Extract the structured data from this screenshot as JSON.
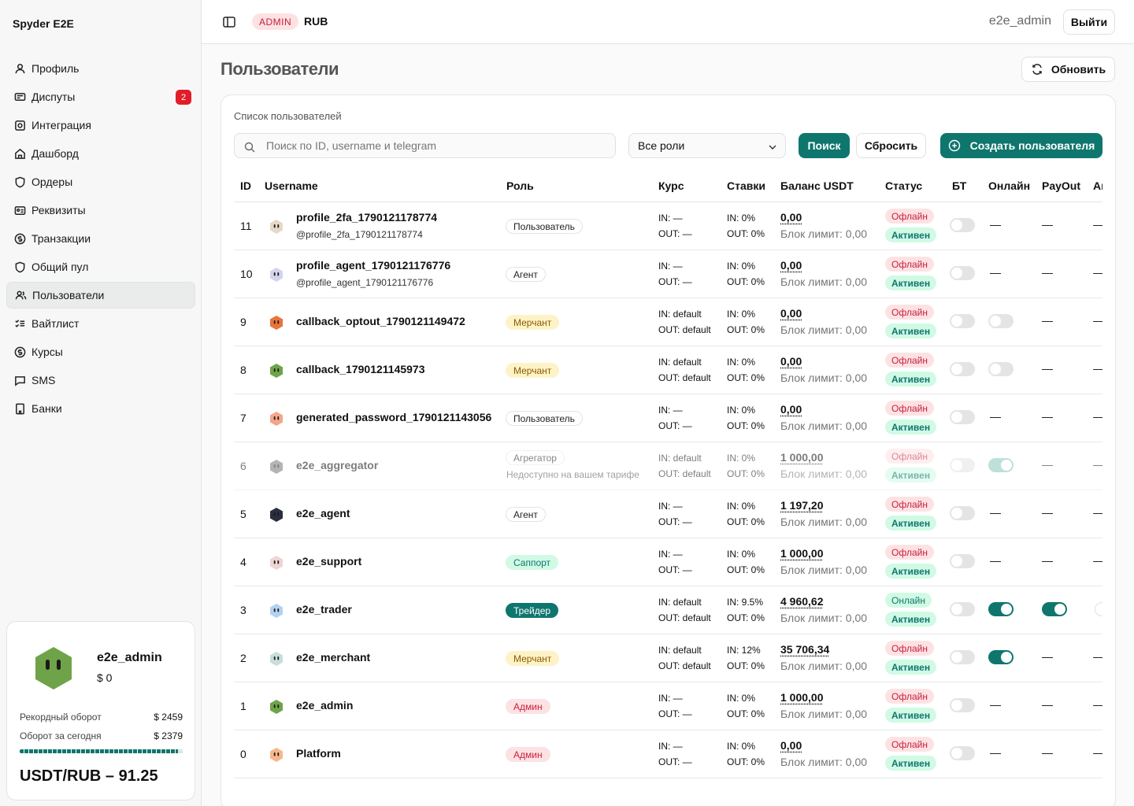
{
  "brand": "Spyder E2E",
  "nav": [
    {
      "label": "Профиль",
      "icon": "user-icon"
    },
    {
      "label": "Диспуты",
      "icon": "dispute-icon",
      "badge": "2"
    },
    {
      "label": "Интеграция",
      "icon": "integration-icon"
    },
    {
      "label": "Дашборд",
      "icon": "home-icon"
    },
    {
      "label": "Ордеры",
      "icon": "shield-icon"
    },
    {
      "label": "Реквизиты",
      "icon": "card-icon"
    },
    {
      "label": "Транзакции",
      "icon": "dollar-icon"
    },
    {
      "label": "Общий пул",
      "icon": "shield-icon"
    },
    {
      "label": "Пользователи",
      "icon": "users-icon",
      "active": true
    },
    {
      "label": "Вайтлист",
      "icon": "checklist-icon"
    },
    {
      "label": "Курсы",
      "icon": "dollar-icon"
    },
    {
      "label": "SMS",
      "icon": "message-icon"
    },
    {
      "label": "Банки",
      "icon": "bank-icon"
    }
  ],
  "profile_card": {
    "name": "e2e_admin",
    "balance": "$ 0",
    "record_label": "Рекордный оборот",
    "record_value": "$ 2459",
    "today_label": "Оборот за сегодня",
    "today_value": "$ 2379",
    "progress": 0.97,
    "rate": "USDT/RUB – 91.25"
  },
  "header": {
    "badge": "ADMIN",
    "currency": "RUB",
    "user": "e2e_admin",
    "logout": "Выйти"
  },
  "page": {
    "title": "Пользователи",
    "refresh": "Обновить"
  },
  "panel": {
    "title": "Список пользователей",
    "search_placeholder": "Поиск по ID, username и telegram",
    "roles": "Все роли",
    "search_btn": "Поиск",
    "reset_btn": "Сбросить",
    "create_btn": "Создать пользователя"
  },
  "columns": [
    "ID",
    "Username",
    "Роль",
    "Курс",
    "Ставки",
    "Баланс USDT",
    "Статус",
    "БТ",
    "Онлайн",
    "PayOut",
    "Аг"
  ],
  "colors": {
    "accent": "#0f766e",
    "danger": "#c81e3a"
  },
  "rows": [
    {
      "id": "11",
      "username": "profile_2fa_1790121178774",
      "handle": "@profile_2fa_1790121178774",
      "role": "Пользователь",
      "role_class": "r-user",
      "kurs_in": "IN: —",
      "kurs_out": "OUT: —",
      "st_in": "IN: 0%",
      "st_out": "OUT: 0%",
      "balance": "0,00",
      "limit": "Блок лимит: 0,00",
      "status": "Офлайн",
      "active": "Активен",
      "avatar": "#e6d8c8",
      "online": "—",
      "payout": "—",
      "agg": "—"
    },
    {
      "id": "10",
      "username": "profile_agent_1790121176776",
      "handle": "@profile_agent_1790121176776",
      "role": "Агент",
      "role_class": "r-agent",
      "kurs_in": "IN: —",
      "kurs_out": "OUT: —",
      "st_in": "IN: 0%",
      "st_out": "OUT: 0%",
      "balance": "0,00",
      "limit": "Блок лимит: 0,00",
      "status": "Офлайн",
      "active": "Активен",
      "avatar": "#d4d4ee",
      "online": "—",
      "payout": "—",
      "agg": "—"
    },
    {
      "id": "9",
      "username": "callback_optout_1790121149472",
      "role": "Мерчант",
      "role_class": "r-merch",
      "kurs_in": "IN: default",
      "kurs_out": "OUT: default",
      "st_in": "IN: 0%",
      "st_out": "OUT: 0%",
      "balance": "0,00",
      "limit": "Блок лимит: 0,00",
      "status": "Офлайн",
      "active": "Активен",
      "avatar": "#e8743b",
      "online_toggle": "off",
      "payout": "—",
      "agg": "—"
    },
    {
      "id": "8",
      "username": "callback_1790121145973",
      "role": "Мерчант",
      "role_class": "r-merch",
      "kurs_in": "IN: default",
      "kurs_out": "OUT: default",
      "st_in": "IN: 0%",
      "st_out": "OUT: 0%",
      "balance": "0,00",
      "limit": "Блок лимит: 0,00",
      "status": "Офлайн",
      "active": "Активен",
      "avatar": "#6fa34a",
      "online_toggle": "off",
      "payout": "—",
      "agg": "—"
    },
    {
      "id": "7",
      "username": "generated_password_1790121143056",
      "role": "Пользователь",
      "role_class": "r-user",
      "kurs_in": "IN: —",
      "kurs_out": "OUT: —",
      "st_in": "IN: 0%",
      "st_out": "OUT: 0%",
      "balance": "0,00",
      "limit": "Блок лимит: 0,00",
      "status": "Офлайн",
      "active": "Активен",
      "avatar": "#f4a58a",
      "online": "—",
      "payout": "—",
      "agg": "—"
    },
    {
      "id": "6",
      "username": "e2e_aggregator",
      "role": "Агрегатор",
      "role_note": "Недоступно на вашем тарифе",
      "role_class": "r-agg",
      "kurs_in": "IN: default",
      "kurs_out": "OUT: default",
      "st_in": "IN: 0%",
      "st_out": "OUT: 0%",
      "balance": "1 000,00",
      "limit": "Блок лимит: 0,00",
      "status": "Офлайн",
      "active": "Активен",
      "avatar": "#777777",
      "online_toggle": "semi",
      "payout": "—",
      "agg": "—",
      "dim": true
    },
    {
      "id": "5",
      "username": "e2e_agent",
      "role": "Агент",
      "role_class": "r-agent",
      "kurs_in": "IN: —",
      "kurs_out": "OUT: —",
      "st_in": "IN: 0%",
      "st_out": "OUT: 0%",
      "balance": "1 197,20",
      "limit": "Блок лимит: 0,00",
      "status": "Офлайн",
      "active": "Активен",
      "avatar": "#2a2f3f",
      "online": "—",
      "payout": "—",
      "agg": "—"
    },
    {
      "id": "4",
      "username": "e2e_support",
      "role": "Саппорт",
      "role_class": "r-support",
      "kurs_in": "IN: —",
      "kurs_out": "OUT: —",
      "st_in": "IN: 0%",
      "st_out": "OUT: 0%",
      "balance": "1 000,00",
      "limit": "Блок лимит: 0,00",
      "status": "Офлайн",
      "active": "Активен",
      "avatar": "#efd4d4",
      "online": "—",
      "payout": "—",
      "agg": "—"
    },
    {
      "id": "3",
      "username": "e2e_trader",
      "role": "Трейдер",
      "role_class": "r-trader",
      "kurs_in": "IN: default",
      "kurs_out": "OUT: default",
      "st_in": "IN: 9.5%",
      "st_out": "OUT: 0%",
      "balance": "4 960,62",
      "limit": "Блок лимит: 0,00",
      "status": "Онлайн",
      "status_on": true,
      "active": "Активен",
      "avatar": "#b3d2f2",
      "online_toggle": "on",
      "payout_toggle": "on",
      "agg_toggle": "off"
    },
    {
      "id": "2",
      "username": "e2e_merchant",
      "role": "Мерчант",
      "role_class": "r-merch",
      "kurs_in": "IN: default",
      "kurs_out": "OUT: default",
      "st_in": "IN: 12%",
      "st_out": "OUT: 0%",
      "balance": "35 706,34",
      "limit": "Блок лимит: 0,00",
      "status": "Офлайн",
      "active": "Активен",
      "avatar": "#c7dedb",
      "online_toggle": "on",
      "payout": "—",
      "agg": "—"
    },
    {
      "id": "1",
      "username": "e2e_admin",
      "role": "Админ",
      "role_class": "r-admin",
      "kurs_in": "IN: —",
      "kurs_out": "OUT: —",
      "st_in": "IN: 0%",
      "st_out": "OUT: 0%",
      "balance": "1 000,00",
      "limit": "Блок лимит: 0,00",
      "status": "Офлайн",
      "active": "Активен",
      "avatar": "#6fa34a",
      "online": "—",
      "payout": "—",
      "agg": "—"
    },
    {
      "id": "0",
      "username": "Platform",
      "role": "Админ",
      "role_class": "r-admin",
      "kurs_in": "IN: —",
      "kurs_out": "OUT: —",
      "st_in": "IN: 0%",
      "st_out": "OUT: 0%",
      "balance": "0,00",
      "limit": "Блок лимит: 0,00",
      "status": "Офлайн",
      "active": "Активен",
      "avatar": "#f8b68a",
      "online": "—",
      "payout": "—",
      "agg": "—"
    }
  ]
}
